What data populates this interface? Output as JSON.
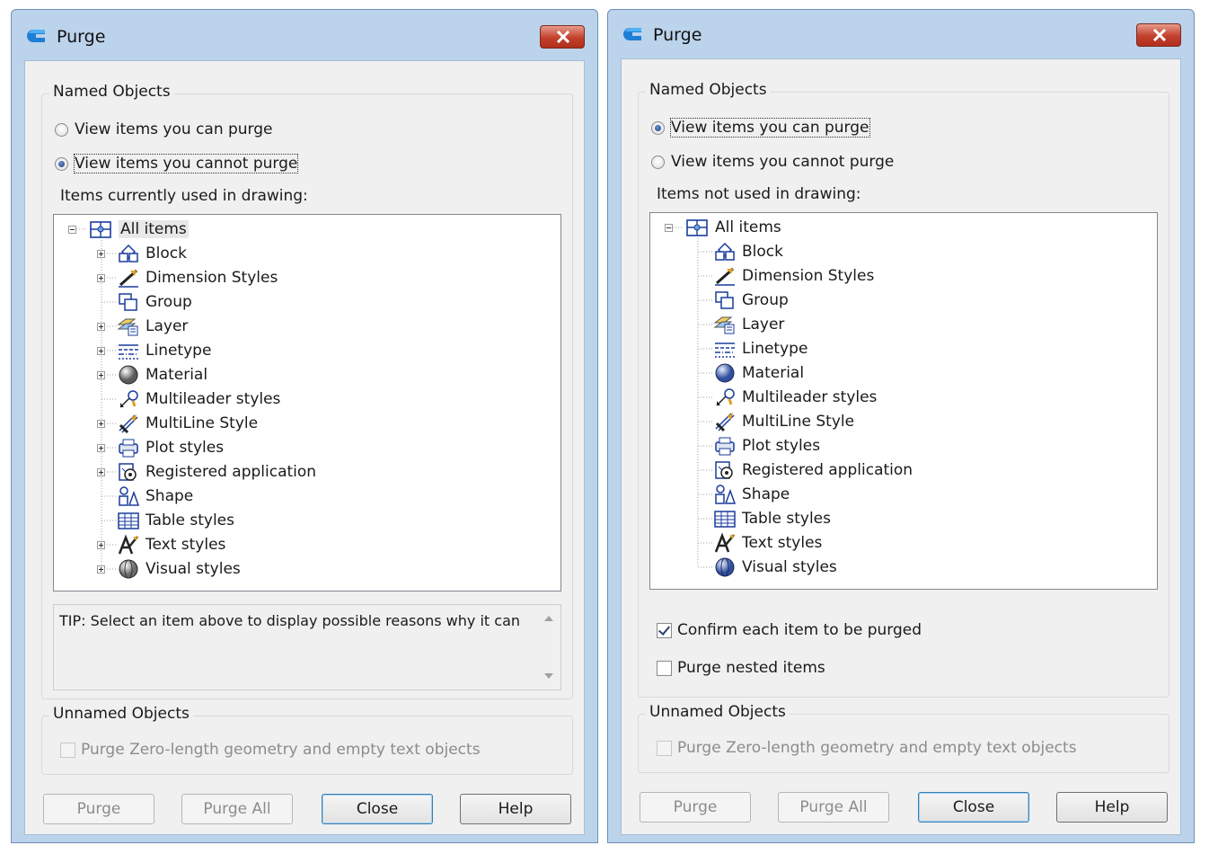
{
  "left_dialog": {
    "title": "Purge",
    "named_objects": {
      "label": "Named Objects",
      "radio_can_purge": "View items you can purge",
      "radio_cannot_purge": "View items you cannot purge",
      "selected": "cannot_purge"
    },
    "caption": "Items currently used in drawing:",
    "tree": {
      "root": "All items",
      "items": [
        {
          "label": "Block",
          "expandable": true
        },
        {
          "label": "Dimension Styles",
          "expandable": true
        },
        {
          "label": "Group",
          "expandable": false
        },
        {
          "label": "Layer",
          "expandable": true
        },
        {
          "label": "Linetype",
          "expandable": true
        },
        {
          "label": "Material",
          "expandable": true
        },
        {
          "label": "Multileader styles",
          "expandable": false
        },
        {
          "label": "MultiLine Style",
          "expandable": true
        },
        {
          "label": "Plot styles",
          "expandable": true
        },
        {
          "label": "Registered application",
          "expandable": true
        },
        {
          "label": "Shape",
          "expandable": false
        },
        {
          "label": "Table styles",
          "expandable": false
        },
        {
          "label": "Text styles",
          "expandable": true
        },
        {
          "label": "Visual styles",
          "expandable": true
        }
      ]
    },
    "tip": "TIP: Select an item above to display possible reasons why it can",
    "unnamed_objects": {
      "label": "Unnamed Objects",
      "checkbox": "Purge Zero-length geometry and empty text objects"
    },
    "buttons": {
      "purge": "Purge",
      "purge_all": "Purge All",
      "close": "Close",
      "help": "Help"
    }
  },
  "right_dialog": {
    "title": "Purge",
    "named_objects": {
      "label": "Named Objects",
      "radio_can_purge": "View items you can purge",
      "radio_cannot_purge": "View items you cannot purge",
      "selected": "can_purge"
    },
    "caption": "Items not used in drawing:",
    "tree": {
      "root": "All items",
      "items": [
        {
          "label": "Block",
          "expandable": false
        },
        {
          "label": "Dimension Styles",
          "expandable": false
        },
        {
          "label": "Group",
          "expandable": false
        },
        {
          "label": "Layer",
          "expandable": false
        },
        {
          "label": "Linetype",
          "expandable": false
        },
        {
          "label": "Material",
          "expandable": false
        },
        {
          "label": "Multileader styles",
          "expandable": false
        },
        {
          "label": "MultiLine Style",
          "expandable": false
        },
        {
          "label": "Plot styles",
          "expandable": false
        },
        {
          "label": "Registered application",
          "expandable": false
        },
        {
          "label": "Shape",
          "expandable": false
        },
        {
          "label": "Table styles",
          "expandable": false
        },
        {
          "label": "Text styles",
          "expandable": false
        },
        {
          "label": "Visual styles",
          "expandable": false
        }
      ]
    },
    "confirm_checkbox": {
      "label": "Confirm each item to be purged",
      "checked": true
    },
    "nested_checkbox": {
      "label": "Purge nested items",
      "checked": false
    },
    "unnamed_objects": {
      "label": "Unnamed Objects",
      "checkbox": "Purge Zero-length geometry and empty text objects"
    },
    "buttons": {
      "purge": "Purge",
      "purge_all": "Purge All",
      "close": "Close",
      "help": "Help"
    }
  },
  "icons": [
    "purge-app-icon",
    "close-icon",
    "all-items-icon",
    "block-icon",
    "dimension-styles-icon",
    "group-icon",
    "layer-icon",
    "linetype-icon",
    "material-icon",
    "multileader-styles-icon",
    "multiline-style-icon",
    "plot-styles-icon",
    "registered-application-icon",
    "shape-icon",
    "table-styles-icon",
    "text-styles-icon",
    "visual-styles-icon"
  ]
}
